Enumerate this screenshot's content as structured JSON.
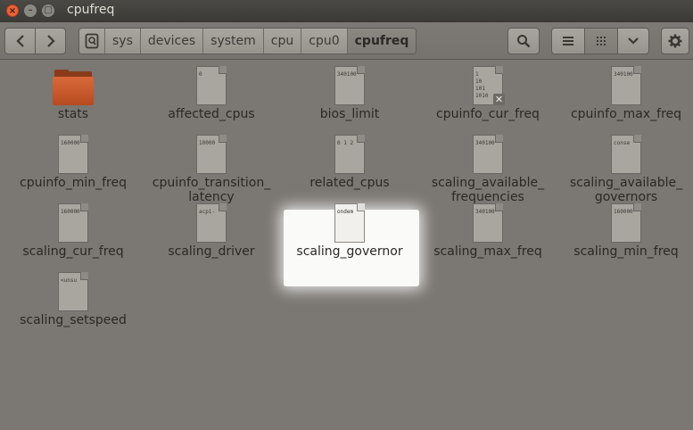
{
  "window": {
    "title": "cpufreq"
  },
  "toolbar": {
    "breadcrumbs": [
      "sys",
      "devices",
      "system",
      "cpu",
      "cpu0",
      "cpufreq"
    ]
  },
  "items": [
    {
      "name": "stats",
      "type": "folder",
      "preview": ""
    },
    {
      "name": "affected_cpus",
      "type": "file",
      "preview": "0"
    },
    {
      "name": "bios_limit",
      "type": "file",
      "preview": "340100"
    },
    {
      "name": "cpuinfo_cur_freq",
      "type": "file",
      "preview": "1\n10\n101\n1010",
      "badge": "✕"
    },
    {
      "name": "cpuinfo_max_freq",
      "type": "file",
      "preview": "340100"
    },
    {
      "name": "cpuinfo_min_freq",
      "type": "file",
      "preview": "160000"
    },
    {
      "name": "cpuinfo_transition_\nlatency",
      "type": "file",
      "preview": "10000"
    },
    {
      "name": "related_cpus",
      "type": "file",
      "preview": "0 1 2"
    },
    {
      "name": "scaling_available_\nfrequencies",
      "type": "file",
      "preview": "340100"
    },
    {
      "name": "scaling_available_\ngovernors",
      "type": "file",
      "preview": "conse"
    },
    {
      "name": "scaling_cur_freq",
      "type": "file",
      "preview": "160000"
    },
    {
      "name": "scaling_driver",
      "type": "file",
      "preview": "acpi-"
    },
    {
      "name": "scaling_governor",
      "type": "file",
      "preview": "ondem",
      "selected": true
    },
    {
      "name": "scaling_max_freq",
      "type": "file",
      "preview": "340100"
    },
    {
      "name": "scaling_min_freq",
      "type": "file",
      "preview": "160000"
    },
    {
      "name": "scaling_setspeed",
      "type": "file",
      "preview": "<unsu"
    }
  ]
}
